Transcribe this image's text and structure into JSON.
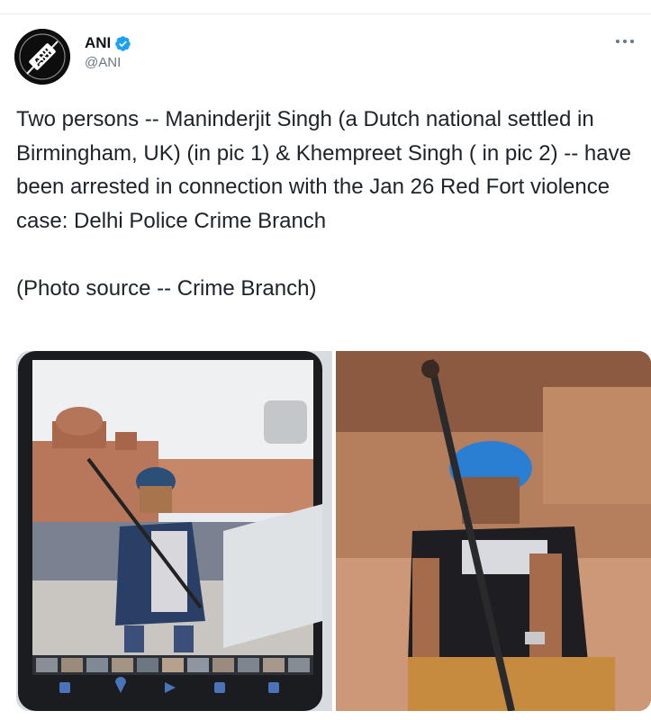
{
  "tweet": {
    "author": {
      "name": "ANI",
      "handle": "@ANI",
      "avatar_text": "ANI",
      "verified": true
    },
    "text": "Two persons -- Maninderjit Singh (a Dutch national settled in Birmingham, UK) (in pic 1) & Khempreet Singh ( in pic 2) -- have been arrested in connection with the Jan 26 Red Fort violence case: Delhi Police Crime Branch\n\n(Photo source -- Crime Branch)",
    "media": [
      {
        "name": "pic-1",
        "icon": "phone-screen-photo"
      },
      {
        "name": "pic-2",
        "icon": "close-up-photo"
      }
    ]
  },
  "colors": {
    "verified": "#1da1f2",
    "secondary_text": "#657786",
    "divider": "#e6ecf0"
  }
}
